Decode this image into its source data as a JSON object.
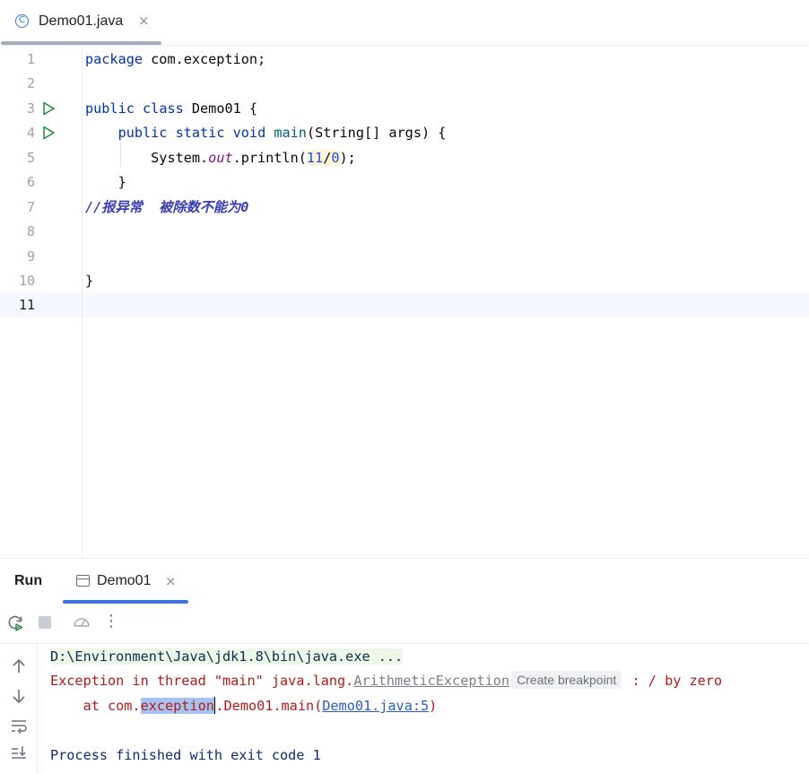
{
  "editor_tab": {
    "icon": "java-class-icon",
    "icon_glyph": "C",
    "label": "Demo01.java",
    "close": "×"
  },
  "editor": {
    "line_numbers": [
      "1",
      "2",
      "3",
      "4",
      "5",
      "6",
      "7",
      "8",
      "9",
      "10",
      "11"
    ],
    "current_line": 11,
    "lines": {
      "l1_kw": "package",
      "l1_rest": " com.exception;",
      "l3_kw1": "public",
      "l3_kw2": "class",
      "l3_rest": " Demo01 {",
      "l4_kw1": "public",
      "l4_kw2": "static",
      "l4_kw3": "void",
      "l4_fn": "main",
      "l4_rest": "(String[] args) {",
      "l5_obj": "System.",
      "l5_static": "out",
      "l5_call": ".println(",
      "l5_num1": "11",
      "l5_slash": "/",
      "l5_num2": "0",
      "l5_end": ");",
      "l6": "}",
      "l7_comment": "//报异常  被除数不能为0",
      "l10": "}"
    }
  },
  "run_window": {
    "title": "Run",
    "tab_label": "Demo01",
    "tab_close": "×",
    "toolbar_icons": [
      "rerun-icon",
      "stop-icon",
      "profiler-icon",
      "more-icon"
    ],
    "more_glyph": "⋮",
    "side_icons": [
      "scroll-up-icon",
      "scroll-down-icon",
      "soft-wrap-icon",
      "scroll-to-end-icon"
    ],
    "console": {
      "command": "D:\\Environment\\Java\\jdk1.8\\bin\\java.exe ...",
      "exc_prefix": "Exception in thread \"main\" java.lang.",
      "exc_class": "ArithmeticException",
      "breakpoint_badge": "Create breakpoint",
      "exc_suffix": " : / by zero",
      "at_prefix": "    at com.",
      "at_selected": "exception",
      "at_middle": ".Demo01.main(",
      "at_link": "Demo01.java:5",
      "at_end": ")",
      "finished": "Process finished with exit code 1"
    }
  }
}
